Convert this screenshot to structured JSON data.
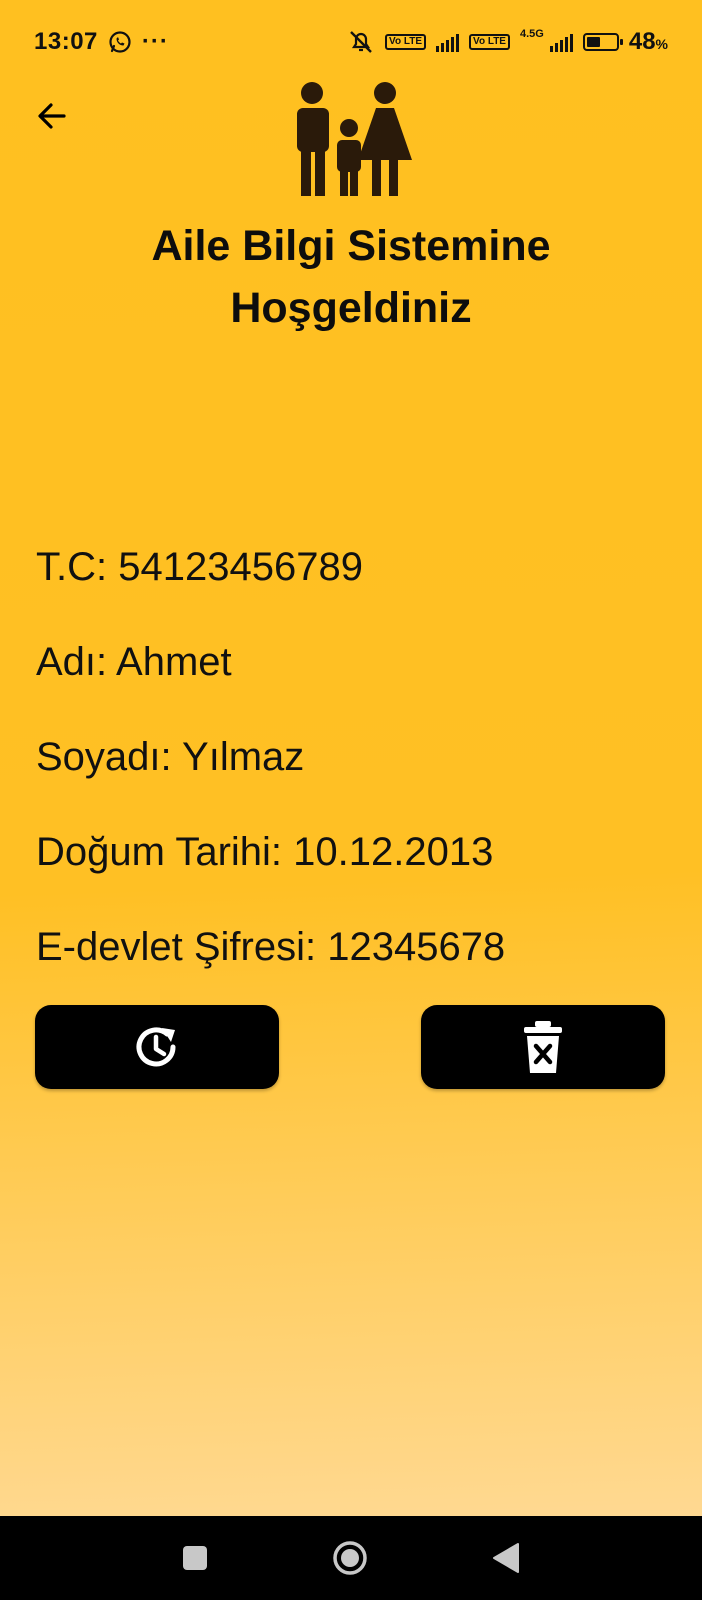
{
  "status_bar": {
    "time": "13:07",
    "overflow": "···",
    "volte_1": "Vo LTE",
    "volte_2": "Vo LTE",
    "network": "4.5G",
    "battery_percent": "48",
    "battery_unit": "%",
    "battery_level": 0.48,
    "icons": [
      "whatsapp-icon",
      "mute-icon",
      "signal-icon",
      "battery-icon"
    ]
  },
  "header": {
    "back_icon": "arrow-left-icon",
    "logo_icon": "family-icon",
    "title_line1": "Aile Bilgi Sistemine",
    "title_line2": "Hoşgeldiniz"
  },
  "info": {
    "tc": "T.C: 54123456789",
    "name": "Adı: Ahmet",
    "surname": "Soyadı: Yılmaz",
    "birth_date": "Doğum Tarihi: 10.12.2013",
    "edevlet_password": "E-devlet Şifresi: 12345678"
  },
  "actions": {
    "update_icon": "clock-refresh-icon",
    "delete_icon": "trash-x-icon"
  },
  "nav": {
    "icons": [
      "square-icon",
      "circle-icon",
      "triangle-back-icon"
    ]
  },
  "colors": {
    "background_top": "#ffc020",
    "background_bottom": "#ffdca0",
    "button": "#000000",
    "text": "#111111"
  }
}
